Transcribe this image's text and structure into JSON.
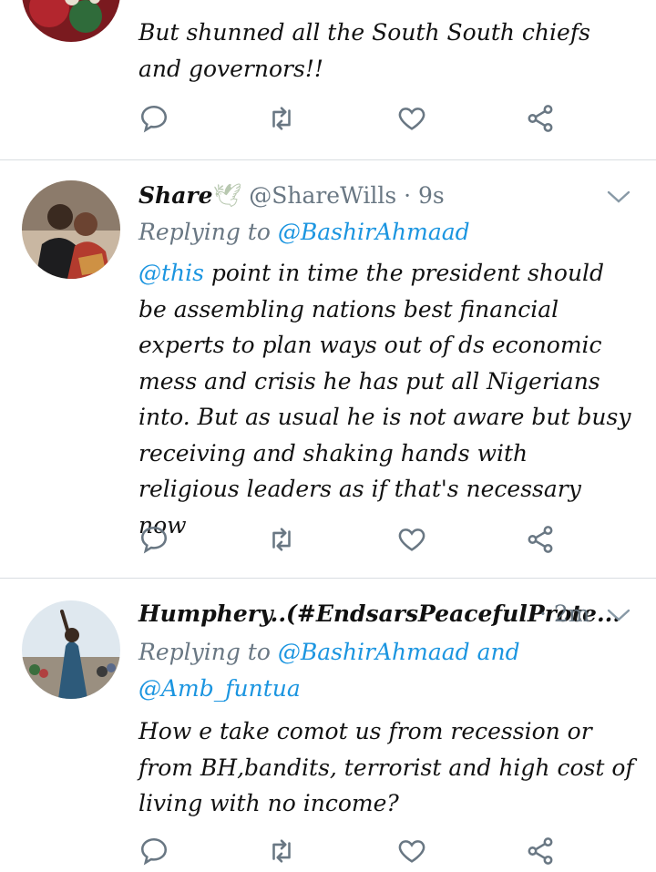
{
  "tweets": [
    {
      "body": "But shunned all the South South chiefs and governors!!",
      "actions": [
        "reply",
        "retweet",
        "like",
        "share"
      ]
    },
    {
      "name": "Share",
      "name_emoji": "🕊",
      "handle": "@ShareWills",
      "time": "· 9s",
      "reply_prefix": "Replying to ",
      "reply_to": "@BashirAhmaad",
      "body_mention": "@this",
      "body": " point in time the president should be assembling nations best financial experts to plan ways out of ds economic mess and crisis he has put all Nigerians into. But as usual he is not aware but busy receiving and shaking hands with religious leaders as if that's necessary now"
    },
    {
      "name": "Humphery..(#EndsarsPeacefulProte...",
      "time": "· 2m",
      "reply_prefix": "Replying to ",
      "reply_to": "@BashirAhmaad and",
      "reply_to_2": "@Amb_funtua",
      "body": "How e take comot us from recession or from BH,bandits, terrorist and high cost of living with no income?"
    }
  ],
  "colors": {
    "accent": "#1b95e0",
    "muted": "#697783",
    "divider": "#d9dde1"
  }
}
